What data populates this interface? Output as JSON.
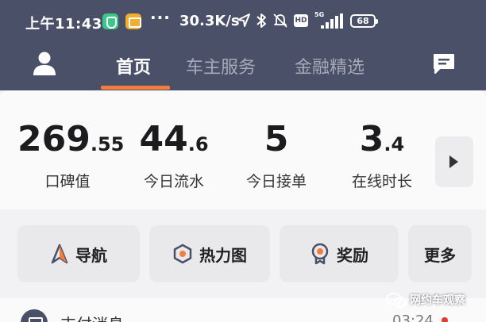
{
  "status_bar": {
    "time": "上午11:43",
    "dots": "···",
    "speed": "30.3K/s",
    "hd": "HD",
    "network_gen": "5G",
    "battery": "68"
  },
  "nav": {
    "tabs": [
      {
        "label": "首页",
        "active": true
      },
      {
        "label": "车主服务",
        "active": false
      },
      {
        "label": "金融精选",
        "active": false
      }
    ]
  },
  "stats": [
    {
      "int": "269",
      "dec": ".55",
      "label": "口碑值"
    },
    {
      "int": "44",
      "dec": ".6",
      "label": "今日流水"
    },
    {
      "int": "5",
      "dec": "",
      "label": "今日接单"
    },
    {
      "int": "3",
      "dec": ".4",
      "label": "在线时长"
    }
  ],
  "quick_actions": [
    {
      "label": "导航",
      "icon": "navigation-arrow-icon"
    },
    {
      "label": "热力图",
      "icon": "heatmap-hexagon-icon"
    },
    {
      "label": "奖励",
      "icon": "reward-medal-icon"
    },
    {
      "label": "更多",
      "icon": ""
    }
  ],
  "bottom": {
    "title": "支付消息",
    "time": "03:24"
  },
  "watermark": "网约车观察",
  "colors": {
    "header_bg": "#4a5068",
    "accent": "#f57d3b",
    "inactive_tab": "#a6a9b8"
  }
}
